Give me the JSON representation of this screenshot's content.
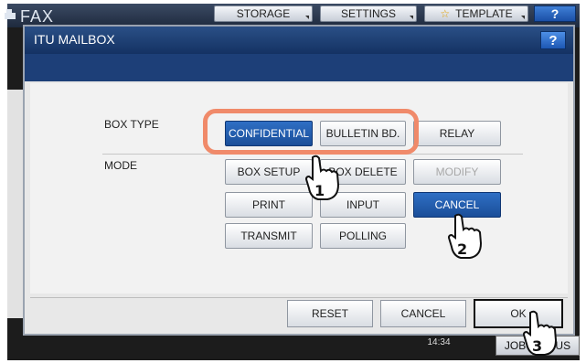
{
  "app": {
    "title": "FAX"
  },
  "topbar": {
    "storage_label": "STORAGE",
    "settings_label": "SETTINGS",
    "template_label": "TEMPLATE",
    "help_label": "?"
  },
  "dialog": {
    "title": "ITU MAILBOX",
    "help_label": "?",
    "box_type_label": "BOX TYPE",
    "mode_label": "MODE",
    "box_type_options": [
      "CONFIDENTIAL",
      "BULLETIN BD.",
      "RELAY"
    ],
    "selected_box_type": "CONFIDENTIAL",
    "mode_buttons": {
      "box_setup": "BOX SETUP",
      "box_delete": "BOX DELETE",
      "modify": "MODIFY",
      "print": "PRINT",
      "input": "INPUT",
      "cancel": "CANCEL",
      "transmit": "TRANSMIT",
      "polling": "POLLING"
    },
    "selected_mode": "CANCEL",
    "footer": {
      "reset_label": "RESET",
      "cancel_label": "CANCEL",
      "ok_label": "OK"
    }
  },
  "status": {
    "time": "14:34",
    "job_label": "JOB STATUS"
  },
  "steps": [
    "1",
    "2",
    "3"
  ]
}
